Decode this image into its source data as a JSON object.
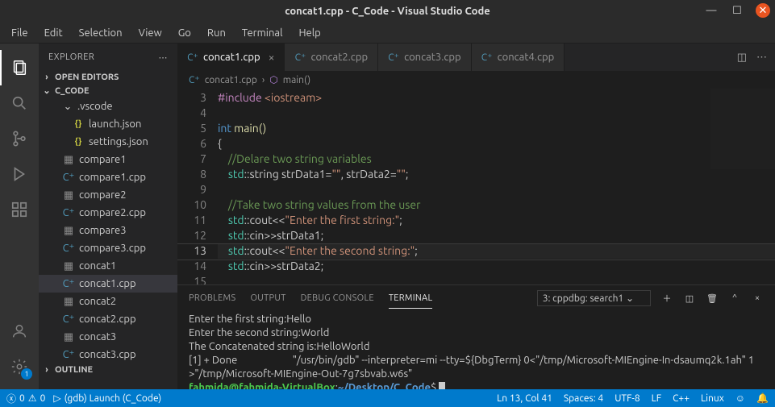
{
  "titlebar": {
    "title": "concat1.cpp - C_Code - Visual Studio Code"
  },
  "menu": [
    "File",
    "Edit",
    "Selection",
    "View",
    "Go",
    "Run",
    "Terminal",
    "Help"
  ],
  "sidebar": {
    "header": "EXPLORER",
    "open_editors": "OPEN EDITORS",
    "workspace": "C_CODE",
    "outline": "OUTLINE",
    "vscode_folder": ".vscode",
    "files": {
      "launch": "launch.json",
      "settings": "settings.json",
      "compare1": "compare1",
      "compare1cpp": "compare1.cpp",
      "compare2": "compare2",
      "compare2cpp": "compare2.cpp",
      "compare3": "compare3",
      "compare3cpp": "compare3.cpp",
      "concat1": "concat1",
      "concat1cpp": "concat1.cpp",
      "concat2": "concat2",
      "concat2cpp": "concat2.cpp",
      "concat3": "concat3",
      "concat3cpp": "concat3.cpp"
    }
  },
  "tabs": {
    "t1": "concat1.cpp",
    "t2": "concat2.cpp",
    "t3": "concat3.cpp",
    "t4": "concat4.cpp"
  },
  "breadcrumb": {
    "file": "concat1.cpp",
    "symbol": "main()"
  },
  "code": {
    "lines": {
      "n3": "3",
      "n4": "4",
      "n5": "5",
      "n6": "6",
      "n7": "7",
      "n8": "8",
      "n9": "9",
      "n10": "10",
      "n11": "11",
      "n12": "12",
      "n13": "13",
      "n14": "14",
      "n15": "15"
    },
    "l3_inc": "#include",
    "l3_lib": "<iostream>",
    "l5_int": "int",
    "l5_main": " main()",
    "l6": "{",
    "l7": "    //Delare two string variables",
    "l8_std": "    std",
    "l8_rest1": "::string strData1=",
    "l8_q1": "\"\"",
    "l8_rest2": ", strData2=",
    "l8_q2": "\"\"",
    "l8_semi": ";",
    "l10": "    //Take two string values from the user",
    "l11_std": "    std",
    "l11_op": "::cout<<",
    "l11_str": "\"Enter the first string:\"",
    "l11_semi": ";",
    "l12_std": "    std",
    "l12_rest": "::cin>>strData1;",
    "l13_std": "    std",
    "l13_op": "::cout<<",
    "l13_str": "\"Enter the second string:\"",
    "l13_semi": ";",
    "l14_std": "    std",
    "l14_rest": "::cin>>strData2;"
  },
  "panel": {
    "tabs": {
      "problems": "PROBLEMS",
      "output": "OUTPUT",
      "debug": "DEBUG CONSOLE",
      "terminal": "TERMINAL"
    },
    "selector": "3: cppdbg: search1",
    "terminal": {
      "l1": "Enter the first string:Hello",
      "l2": "Enter the second string:World",
      "l3": "The Concatenated string is:HelloWorld",
      "l4": "[1] + Done                       \"/usr/bin/gdb\" --interpreter=mi --tty=${DbgTerm} 0<\"/tmp/Microsoft-MIEngine-In-dsaumq2k.1ah\" 1>\"/tmp/Microsoft-MIEngine-Out-7g7sbvab.w6s\"",
      "prompt_user": "fahmida@fahmida-VirtualBox",
      "prompt_colon": ":",
      "prompt_path": "~/Desktop/C_Code",
      "prompt_dollar": "$"
    }
  },
  "status": {
    "errors": "0",
    "warnings": "0",
    "debug": "(gdb) Launch (C_Code)",
    "cursor": "Ln 13, Col 41",
    "spaces": "Spaces: 4",
    "encoding": "UTF-8",
    "eol": "LF",
    "lang": "C++",
    "os": "Linux"
  },
  "activity_badge": "1"
}
